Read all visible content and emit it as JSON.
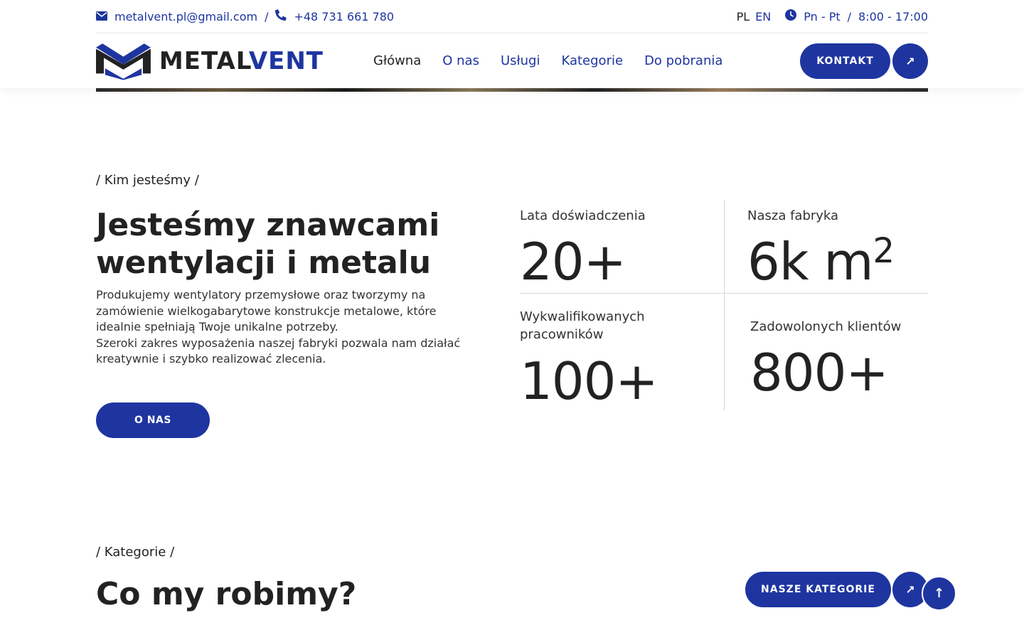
{
  "topbar": {
    "email": "metalvent.pl@gmail.com",
    "separator": "/",
    "phone": "+48 731 661 780",
    "lang_pl": "PL",
    "lang_en": "EN",
    "days": "Pn - Pt",
    "hours_separator": "/",
    "hours": "8:00 - 17:00",
    "icons": [
      "envelope-icon",
      "phone-icon",
      "clock-icon"
    ]
  },
  "logo": {
    "part1": "METAL",
    "part2": "VENT"
  },
  "nav": {
    "items": [
      {
        "label": "Główna",
        "active": true
      },
      {
        "label": "O nas",
        "active": false
      },
      {
        "label": "Usługi",
        "active": false
      },
      {
        "label": "Kategorie",
        "active": false
      },
      {
        "label": "Do pobrania",
        "active": false
      }
    ],
    "contact_label": "KONTAKT",
    "contact_arrow": "↗"
  },
  "about": {
    "eyebrow": "/ Kim jesteśmy /",
    "title_line1": "Jesteśmy znawcami",
    "title_line2": "wentylacji i metalu",
    "paragraph1": "Produkujemy wentylatory przemysłowe oraz tworzymy na zamówienie wielkogabarytowe konstrukcje metalowe, które idealnie spełniają Twoje unikalne potrzeby.",
    "paragraph2": "Szeroki zakres wyposażenia naszej fabryki pozwala nam działać kreatywnie i szybko realizować zlecenia.",
    "button_label": "O NAS"
  },
  "stats": [
    {
      "label": "Lata doświadczenia",
      "value": "20+"
    },
    {
      "label": "Nasza fabryka",
      "value": "6k m",
      "sup": "2"
    },
    {
      "label": "Wykwalifikowanych pracowników",
      "value": "100+"
    },
    {
      "label": "Zadowolonych klientów",
      "value": "800+"
    }
  ],
  "categories": {
    "eyebrow": "/ Kategorie /",
    "title": "Co my robimy?",
    "button_label": "NASZE KATEGORIE",
    "arrow": "↗",
    "to_top": "↑"
  },
  "colors": {
    "brand": "#1e35a0",
    "text": "#222222",
    "divider": "#d8d8d8"
  }
}
